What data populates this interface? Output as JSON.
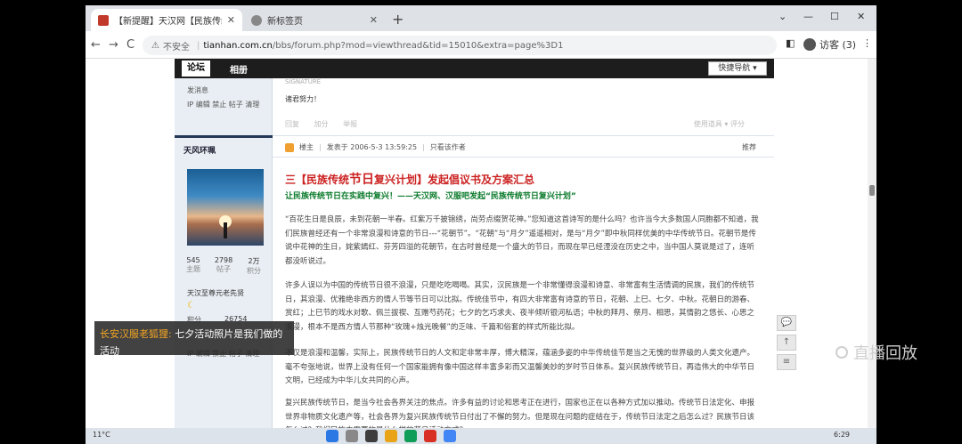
{
  "tabs": [
    {
      "label": "【新提醒】天汉网【民族传统礼...",
      "close": "✕"
    },
    {
      "label": "新标签页",
      "close": "✕"
    }
  ],
  "new_tab_glyph": "+",
  "window_controls": {
    "minimize": "⌄",
    "restore": "—",
    "maximize": "☐",
    "close": "✕"
  },
  "toolbar": {
    "back": "←",
    "forward": "→",
    "reload": "C",
    "security_label": "不安全",
    "url_host": "tianhan.com.cn",
    "url_path": "/bbs/forum.php?mod=viewthread&tid=15010&extra=page%3D1",
    "profile_label": "访客 (3)",
    "menu": "⋮"
  },
  "forum": {
    "nav": [
      {
        "label": "论坛"
      },
      {
        "label": "相册"
      }
    ],
    "quick_nav": "快捷导航 ▾"
  },
  "sidebar": {
    "send_msg": "发消息",
    "ip_line": "IP 编辑 禁止 帖子 清理",
    "username": "天风环珮",
    "stats": [
      {
        "value": "545",
        "label": "主题"
      },
      {
        "value": "2798",
        "label": "帖子"
      },
      {
        "value": "2万",
        "label": "积分"
      }
    ],
    "rank": "天汉至尊元老先贤",
    "points_label": "积分",
    "points_value": "26754",
    "ip_line2": "IP 编辑 禁止 帖子 清理"
  },
  "post": {
    "signature_label": "SIGNATURE",
    "prev_text": "诸君努力！",
    "actions": [
      "回复",
      "加分",
      "举报"
    ],
    "actions_right": "使用道具 ▾   评分",
    "author": "楼主",
    "posted": "发表于 2006-5-3 13:59:25",
    "only_author": "只看该作者",
    "recommend": "推荐",
    "headline_pre": "三【民族传统",
    "headline_big": "节日",
    "headline_post": "复兴计划】发起倡议书及方案汇总",
    "subhead": "让民族传统节日在实践中复兴！——天汉网、汉服吧发起“民族传统节日复兴计划”",
    "paragraphs": [
      "“百花生日是良辰，未到花朝一半春。红紫万千披锦绣，尚劳点缀贺花神。”您知道这首诗写的是什么吗？也许当今大多数国人同胞都不知道，我们民族曾经还有一个非常浪漫和诗意的节日---“花朝节”。“花朝”与“月夕”遥遥相对，是与“月夕”即中秋同样优美的中华传统节日。花朝节是传说中花神的生日，姹紫嫣红、芬芳四溢的花朝节，在古时曾经是一个盛大的节日，而现在早已经湮没在历史之中，当中国人莫说是过了，连听都没听说过。",
      "许多人误以为中国的传统节日很不浪漫，只是吃吃喝喝。其实，汉民族是一个非常懂得浪漫和诗意、非常富有生活情调的民族，我们的传统节日，其浪漫、优雅绝非西方的情人节等节日可以比拟。传统佳节中，有四大非常富有诗意的节日，花朝、上巳、七夕、中秋。花朝日的游春、赏红；上巳节的戏水对歌、佩兰拔禊、互赠芍药花；七夕的乞巧求夫、夜半倾听银河私语；中秋的拜月、祭月、相思，其情韵之悠长、心思之浪漫，根本不是西方情人节那种“玫瑰+烛光晚餐”的乏味、千篇和俗套的样式所能比拟。",
      "不仅是浪漫和温馨，实际上，民族传统节日的人文和定非常丰厚，博大精深，蕴涵多姿的中华传统佳节是当之无愧的世界级的人类文化遗产。毫不夸张地说，世界上没有任何一个国家能拥有像中国这样丰富多彩而又温馨美妙的岁时节日体系。复兴民族传统节日，再造伟大的中华节日文明，已经成为中华儿女共同的心声。",
      "复兴民族传统节日，是当今社会各界关注的焦点。许多有益的讨论和思考正在进行，国家也正在以各种方式加以推动。传统节日法定化、申报世界非物质文化遗产等，社会各界为复兴民族传统节日付出了不懈的努力。但是现在问题的症结在于，传统节日法定之后怎么过？民族节日该怎么过？我们民族中需要的是什么样的节日活动方式？"
    ]
  },
  "rail_icons": [
    "💬",
    "↑",
    "≡"
  ],
  "overlay": {
    "user": "长安汉服老狐狸:",
    "message": " 七夕活动照片是我们做的活动"
  },
  "watermark": "直播回放",
  "taskbar": {
    "weather": "11°C",
    "time": "6:29"
  },
  "colors": {
    "headline_red": "#cc2222",
    "subhead_green": "#0a7a2a",
    "overlay_user": "#f5a623"
  }
}
